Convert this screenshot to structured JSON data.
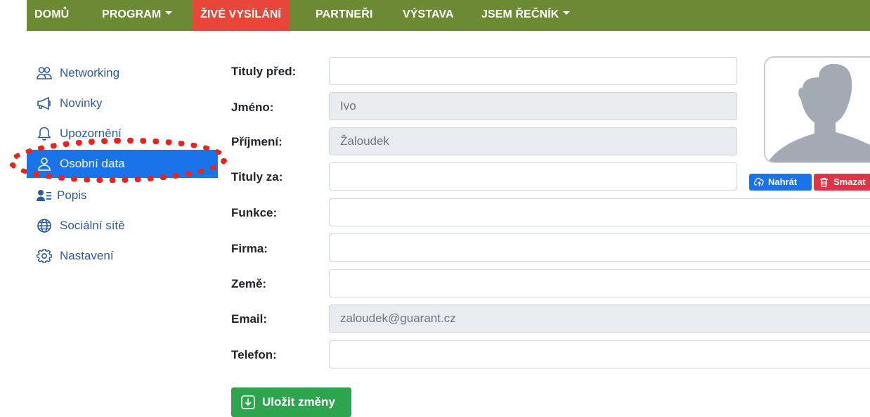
{
  "nav": {
    "items": [
      {
        "label": "DOMŮ",
        "dropdown": false
      },
      {
        "label": "PROGRAM",
        "dropdown": true
      },
      {
        "label": "ŽIVÉ VYSÍLÁNÍ",
        "dropdown": false,
        "active": true
      },
      {
        "label": "PARTNEŘI",
        "dropdown": false
      },
      {
        "label": "VÝSTAVA",
        "dropdown": false
      },
      {
        "label": "JSEM ŘEČNÍK",
        "dropdown": true
      }
    ],
    "bg_color": "#6b8a33",
    "active_color": "#e8463a"
  },
  "sidebar": {
    "items": [
      {
        "label": "Networking",
        "icon": "people-icon"
      },
      {
        "label": "Novinky",
        "icon": "megaphone-icon"
      },
      {
        "label": "Upozornění",
        "icon": "bell-icon"
      },
      {
        "label": "Osobní data",
        "icon": "person-icon",
        "active": true
      },
      {
        "label": "Popis",
        "icon": "person-lines-icon"
      },
      {
        "label": "Sociální sítě",
        "icon": "globe-icon"
      },
      {
        "label": "Nastavení",
        "icon": "gear-icon"
      }
    ],
    "active_color": "#1a73e8",
    "highlight_color": "#e8241d"
  },
  "form": {
    "fields": [
      {
        "label": "Tituly před:",
        "value": "",
        "readonly": false
      },
      {
        "label": "Jméno:",
        "value": "Ivo",
        "readonly": true
      },
      {
        "label": "Příjmení:",
        "value": "Žaloudek",
        "readonly": true
      },
      {
        "label": "Tituly za:",
        "value": "",
        "readonly": false
      },
      {
        "label": "Funkce:",
        "value": "",
        "readonly": false
      },
      {
        "label": "Firma:",
        "value": "",
        "readonly": false
      },
      {
        "label": "Země:",
        "value": "",
        "readonly": false
      },
      {
        "label": "Email:",
        "value": "zaloudek@guarant.cz",
        "readonly": true
      },
      {
        "label": "Telefon:",
        "value": "",
        "readonly": false
      }
    ],
    "save_label": "Uložit změny",
    "save_color": "#2da44e"
  },
  "avatar": {
    "upload_label": "Nahrát",
    "delete_label": "Smazat",
    "upload_color": "#1a73e8",
    "delete_color": "#dc3545"
  }
}
